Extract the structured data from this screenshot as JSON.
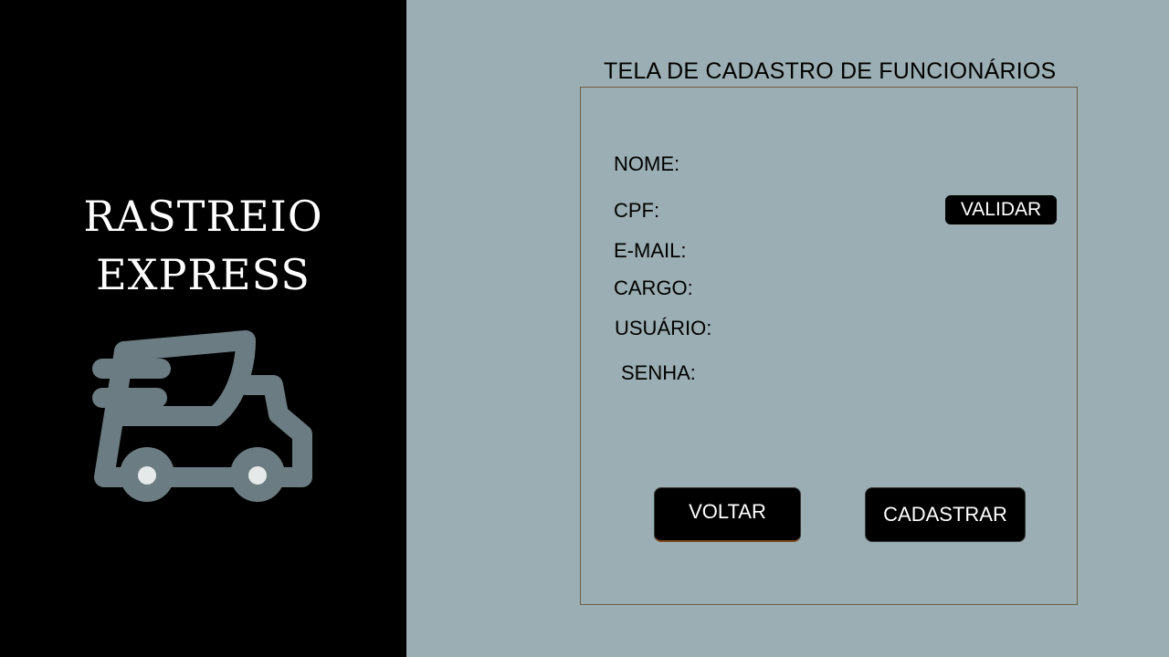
{
  "brand": {
    "line1": "RASTREIO",
    "line2": "EXPRESS",
    "icon": "delivery-truck-icon"
  },
  "form": {
    "title": "TELA DE CADASTRO DE FUNCIONÁRIOS",
    "labels": {
      "nome": "NOME:",
      "cpf": "CPF:",
      "email": "E-MAIL:",
      "cargo": "CARGO:",
      "usuario": "USUÁRIO:",
      "senha": "SENHA:"
    },
    "buttons": {
      "validar": "VALIDAR",
      "voltar": "VOLTAR",
      "cadastrar": "CADASTRAR"
    }
  },
  "colors": {
    "sidebar_bg": "#000000",
    "main_bg": "#9aaeb4",
    "icon_color": "#6b7c82",
    "button_bg": "#000000",
    "button_text": "#ffffff",
    "form_border": "#6e5e42"
  }
}
